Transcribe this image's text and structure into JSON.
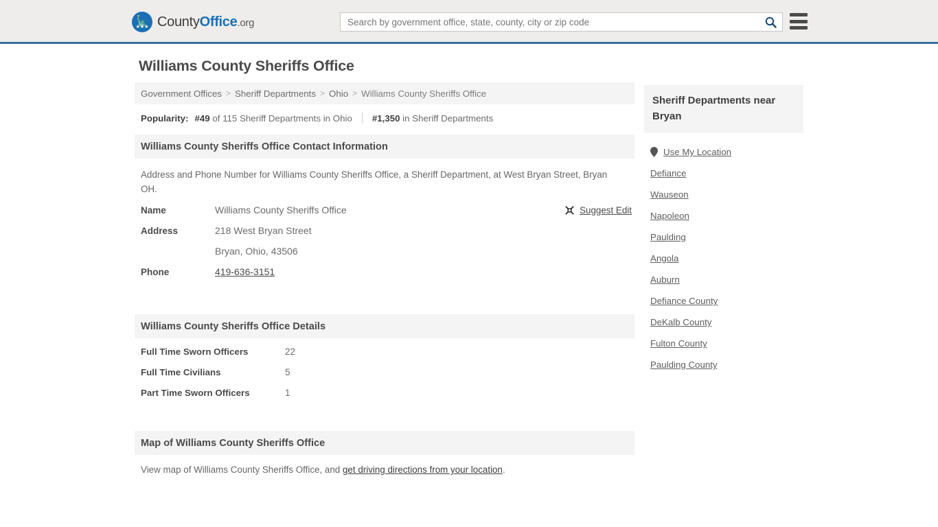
{
  "header": {
    "logo": {
      "part1": "County",
      "part2": "Office",
      "part3": ".org",
      "icon": "eagle-shield-logo"
    },
    "search": {
      "placeholder": "Search by government office, state, county, city or zip code",
      "value": "",
      "icon": "search-icon"
    },
    "menu": {
      "icon": "hamburger-menu-icon"
    },
    "accent_color": "#36709e",
    "background_color": "#eeedeb"
  },
  "main": {
    "page_title": "Williams County Sheriffs Office",
    "breadcrumb": {
      "items": [
        "Government Offices",
        "Sheriff Departments",
        "Ohio",
        "Williams County Sheriffs Office"
      ],
      "separator": ">"
    },
    "popularity": {
      "label": "Popularity:",
      "rank_state_bold": "#49",
      "rank_state_rest": " of 115 Sheriff Departments in Ohio",
      "rank_national_bold": "#1,350",
      "rank_national_rest": " in Sheriff Departments"
    },
    "contact": {
      "heading": "Williams County Sheriffs Office Contact Information",
      "description": "Address and Phone Number for Williams County Sheriffs Office, a Sheriff Department, at West Bryan Street, Bryan OH.",
      "suggest_edit": {
        "label": "Suggest Edit",
        "icon": "suggest-edit-icon"
      },
      "rows": [
        {
          "key": "Name",
          "value": "Williams County Sheriffs Office",
          "link": false
        },
        {
          "key": "Address",
          "value": "218 West Bryan Street",
          "link": false
        },
        {
          "key": "",
          "value": "Bryan, Ohio, 43506",
          "link": false
        },
        {
          "key": "Phone",
          "value": "419-636-3151",
          "link": true
        }
      ]
    },
    "details": {
      "heading": "Williams County Sheriffs Office Details",
      "rows": [
        {
          "key": "Full Time Sworn Officers",
          "value": "22"
        },
        {
          "key": "Full Time Civilians",
          "value": "5"
        },
        {
          "key": "Part Time Sworn Officers",
          "value": "1"
        }
      ]
    },
    "map": {
      "heading": "Map of Williams County Sheriffs Office",
      "text_before": "View map of Williams County Sheriffs Office, and ",
      "link": "get driving directions from your location",
      "text_after": "."
    }
  },
  "aside": {
    "heading": "Sheriff Departments near Bryan",
    "use_my_location": {
      "label": "Use My Location",
      "icon": "map-pin-icon"
    },
    "links": [
      "Defiance",
      "Wauseon",
      "Napoleon",
      "Paulding",
      "Angola",
      "Auburn",
      "Defiance County",
      "DeKalb County",
      "Fulton County",
      "Paulding County"
    ]
  }
}
